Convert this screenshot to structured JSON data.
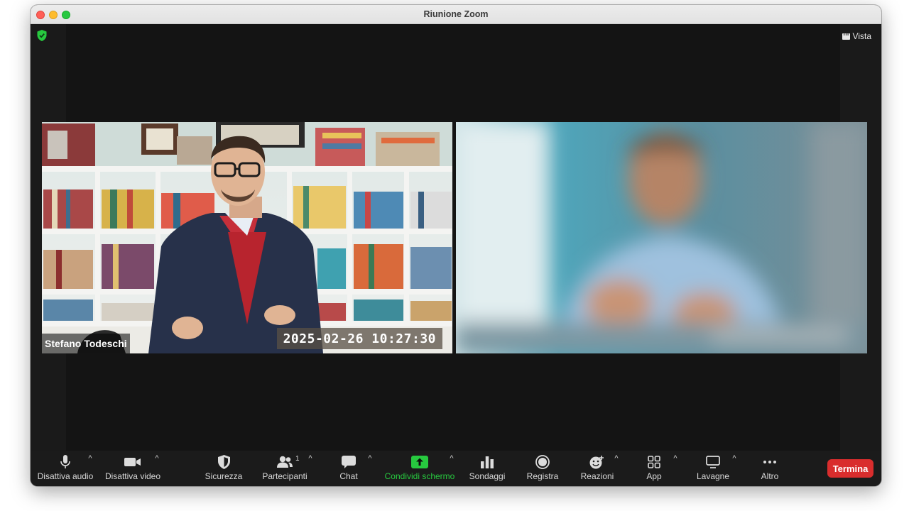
{
  "window": {
    "title": "Riunione Zoom"
  },
  "header": {
    "view_label": "Vista"
  },
  "participants": [
    {
      "name": "Stefano Todeschi",
      "timestamp": "2025-02-26 10:27:30"
    }
  ],
  "toolbar": {
    "mute_audio": "Disattiva audio",
    "stop_video": "Disattiva video",
    "security": "Sicurezza",
    "participants": "Partecipanti",
    "participants_count": "1",
    "chat": "Chat",
    "share_screen": "Condividi schermo",
    "polls": "Sondaggi",
    "record": "Registra",
    "reactions": "Reazioni",
    "apps": "App",
    "whiteboards": "Lavagne",
    "more": "Altro",
    "end": "Termina"
  },
  "colors": {
    "accent_green": "#27c93f",
    "end_red": "#d92d2d"
  }
}
